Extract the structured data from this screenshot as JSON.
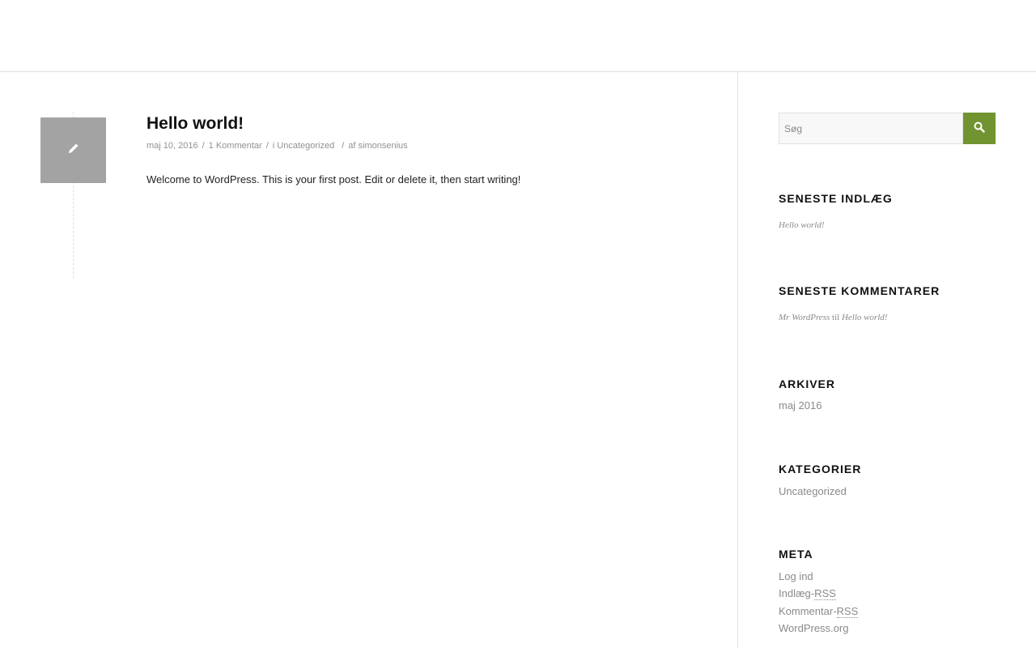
{
  "colors": {
    "accent": "#719430",
    "format_box": "#a3a3a3",
    "meta_text": "#919191",
    "border": "#e1e1e1"
  },
  "post": {
    "format_icon": "pencil-icon",
    "title": "Hello world!",
    "date": "maj 10, 2016",
    "comments": "1 Kommentar",
    "category_prefix": "i ",
    "category": "Uncategorized",
    "author_prefix": "af ",
    "author": "simonsenius",
    "separator": "/",
    "content": "Welcome to WordPress. This is your first post. Edit or delete it, then start writing!"
  },
  "sidebar": {
    "search": {
      "placeholder": "Søg",
      "icon": "search-icon"
    },
    "recent_posts": {
      "title": "SENESTE INDLÆG",
      "items": [
        "Hello world!"
      ]
    },
    "recent_comments": {
      "title": "SENESTE KOMMENTARER",
      "author": "Mr WordPress",
      "connector": "til",
      "post": "Hello world!"
    },
    "archives": {
      "title": "ARKIVER",
      "items": [
        "maj 2016"
      ]
    },
    "categories": {
      "title": "KATEGORIER",
      "items": [
        "Uncategorized"
      ]
    },
    "meta": {
      "title": "META",
      "login": "Log ind",
      "entries_prefix": "Indlæg-",
      "comments_prefix": "Kommentar-",
      "rss": "RSS",
      "wordpress": "WordPress.org"
    }
  }
}
